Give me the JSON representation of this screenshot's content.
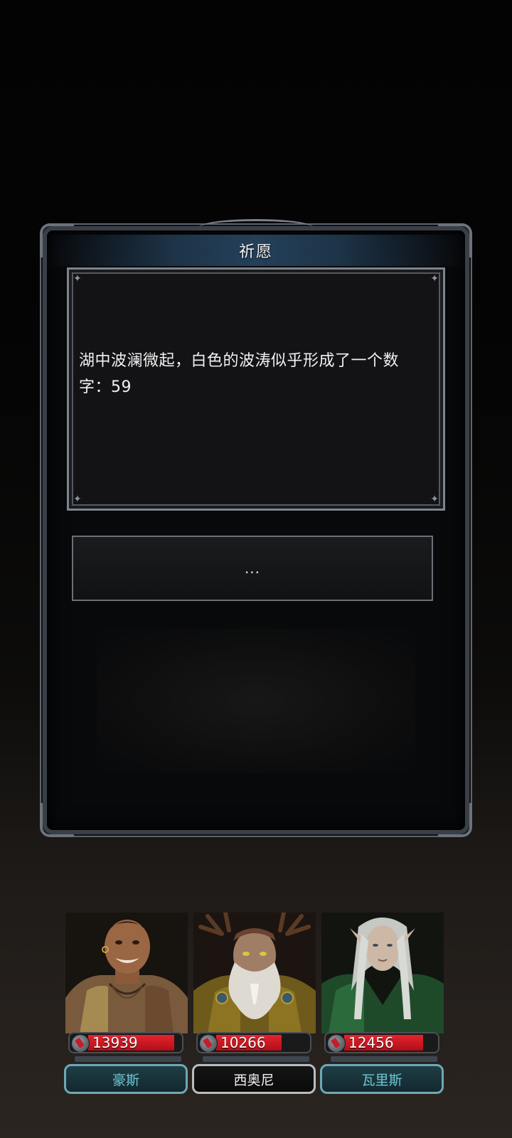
{
  "dialog": {
    "title": "祈愿",
    "message": "湖中波澜微起，白色的波涛似乎形成了一个数字：59",
    "choice_label": "..."
  },
  "party": [
    {
      "name": "豪斯",
      "hp": "13939",
      "hp_fraction": 0.88,
      "selected": false,
      "portrait": "burly-warrior-portrait"
    },
    {
      "name": "西奥尼",
      "hp": "10266",
      "hp_fraction": 0.68,
      "selected": true,
      "portrait": "antlered-druid-portrait"
    },
    {
      "name": "瓦里斯",
      "hp": "12456",
      "hp_fraction": 0.82,
      "selected": false,
      "portrait": "elf-ranger-portrait"
    }
  ],
  "colors": {
    "hp_fill": "#d11a24",
    "title_bar": "#24405a",
    "name_teal": "#6fc6d6"
  }
}
